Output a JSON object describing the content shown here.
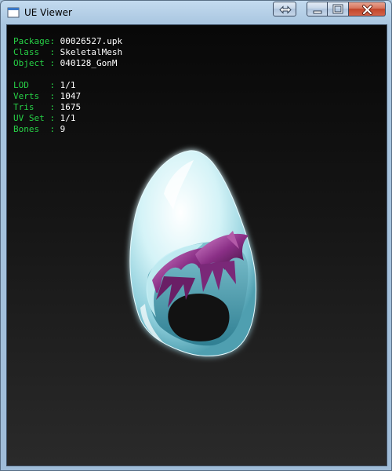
{
  "window": {
    "title": "UE Viewer",
    "buttons": {
      "swap": "swap-arrows-icon",
      "minimize": "minimize-icon",
      "maximize": "maximize-icon",
      "close": "close-icon"
    }
  },
  "info": {
    "package": {
      "label": "Package",
      "value": "00026527.upk"
    },
    "class": {
      "label": "Class  ",
      "value": "SkeletalMesh"
    },
    "object": {
      "label": "Object ",
      "value": "040128_GonM"
    },
    "lod": {
      "label": "LOD    ",
      "value": "1/1"
    },
    "verts": {
      "label": "Verts  ",
      "value": "1047"
    },
    "tris": {
      "label": "Tris   ",
      "value": "1675"
    },
    "uvset": {
      "label": "UV Set ",
      "value": "1/1"
    },
    "bones": {
      "label": "Bones  ",
      "value": "9"
    }
  },
  "colors": {
    "label": "#27d046",
    "value": "#ffffff",
    "hood": "#bfe9f1",
    "hair": "#8a2f86"
  }
}
